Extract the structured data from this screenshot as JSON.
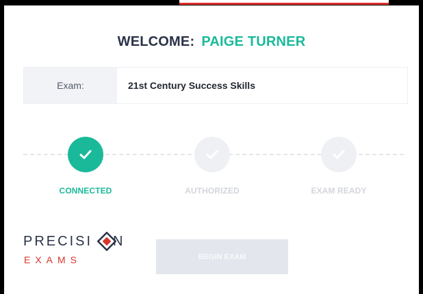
{
  "header": {
    "welcome_label": "WELCOME:",
    "user_name": "PAIGE TURNER"
  },
  "exam": {
    "label": "Exam:",
    "value": "21st Century Success Skills"
  },
  "steps": [
    {
      "label": "CONNECTED",
      "status": "complete",
      "icon": "check-icon"
    },
    {
      "label": "AUTHORIZED",
      "status": "pending",
      "icon": "check-icon"
    },
    {
      "label": "EXAM READY",
      "status": "pending",
      "icon": "check-icon"
    }
  ],
  "logo": {
    "line1_left": "PRECISI",
    "line1_right": "N",
    "line2": "EXAMS"
  },
  "actions": {
    "begin_label": "BEGIN EXAM"
  },
  "colors": {
    "accent": "#1ab99a",
    "heading": "#2a3247",
    "brand_red": "#d7362b",
    "inactive": "#eef0f4"
  }
}
